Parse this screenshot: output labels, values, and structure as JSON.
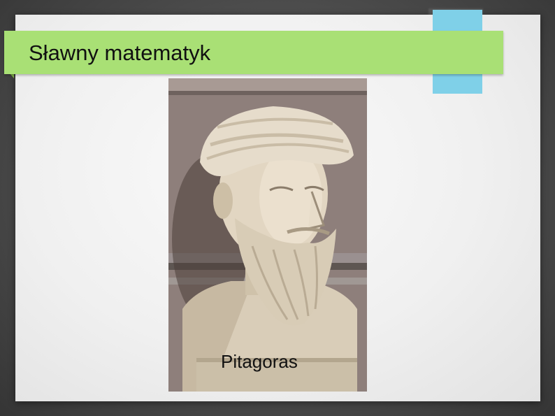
{
  "slide": {
    "title": "Sławny matematyk",
    "caption": "Pitagoras",
    "image_subject": "marble bust of Pythagoras"
  },
  "colors": {
    "title_bar": "#a9e075",
    "accent_tab": "#7fd0e8",
    "background": "#4a4a4a",
    "slide_background": "#f2f2f2"
  }
}
